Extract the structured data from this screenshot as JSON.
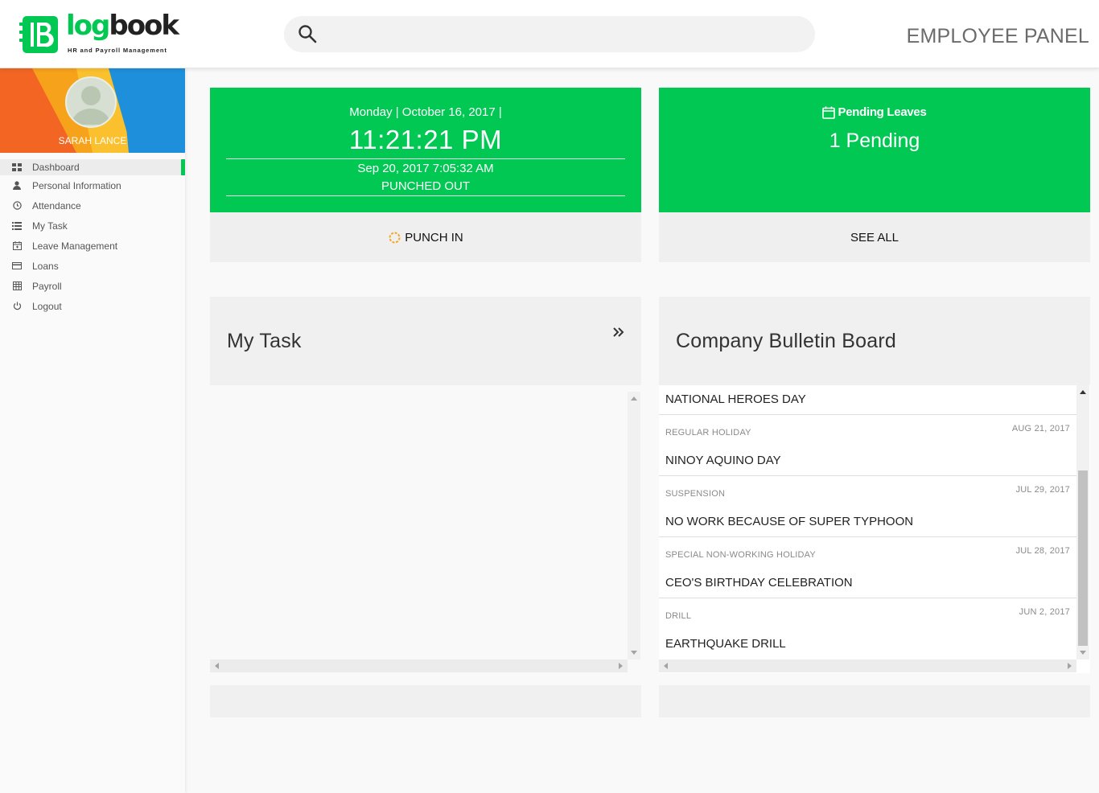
{
  "header": {
    "logo_word_1": "log",
    "logo_word_2": "book",
    "logo_tagline": "HR and Payroll Management",
    "search_placeholder": "",
    "panel_title": "EMPLOYEE PANEL"
  },
  "sidebar": {
    "user_name": "SARAH LANCE",
    "items": [
      {
        "label": "Dashboard",
        "icon": "dashboard-icon",
        "active": true
      },
      {
        "label": "Personal Information",
        "icon": "user-icon",
        "active": false
      },
      {
        "label": "Attendance",
        "icon": "clock-icon",
        "active": false
      },
      {
        "label": "My Task",
        "icon": "list-icon",
        "active": false
      },
      {
        "label": "Leave Management",
        "icon": "calendar-icon",
        "active": false
      },
      {
        "label": "Loans",
        "icon": "credit-card-icon",
        "active": false
      },
      {
        "label": "Payroll",
        "icon": "table-icon",
        "active": false
      },
      {
        "label": "Logout",
        "icon": "power-icon",
        "active": false
      }
    ]
  },
  "clock_card": {
    "date": "Monday | October 16, 2017 |",
    "time": "11:21:21 PM",
    "last_punch": "Sep 20, 2017 7:05:32 AM",
    "status": "PUNCHED OUT",
    "action_label": "PUNCH IN"
  },
  "leave_card": {
    "title": "Pending Leaves",
    "count": "1 Pending",
    "action_label": "SEE ALL"
  },
  "task_section": {
    "title": "My Task"
  },
  "bulletin": {
    "title": "Company Bulletin Board",
    "first_item": "NATIONAL HEROES DAY",
    "items": [
      {
        "type": "REGULAR HOLIDAY",
        "date": "AUG 21, 2017",
        "name": "NINOY AQUINO DAY"
      },
      {
        "type": "SUSPENSION",
        "date": "JUL 29, 2017",
        "name": "NO WORK BECAUSE OF SUPER TYPHOON"
      },
      {
        "type": "SPECIAL NON-WORKING HOLIDAY",
        "date": "JUL 28, 2017",
        "name": "CEO'S BIRTHDAY CELEBRATION"
      },
      {
        "type": "DRILL",
        "date": "JUN 2, 2017",
        "name": "EARTHQUAKE DRILL"
      }
    ]
  },
  "colors": {
    "accent": "#00c853",
    "card_footer": "#efefef",
    "punch_icon": "#f5a623"
  }
}
